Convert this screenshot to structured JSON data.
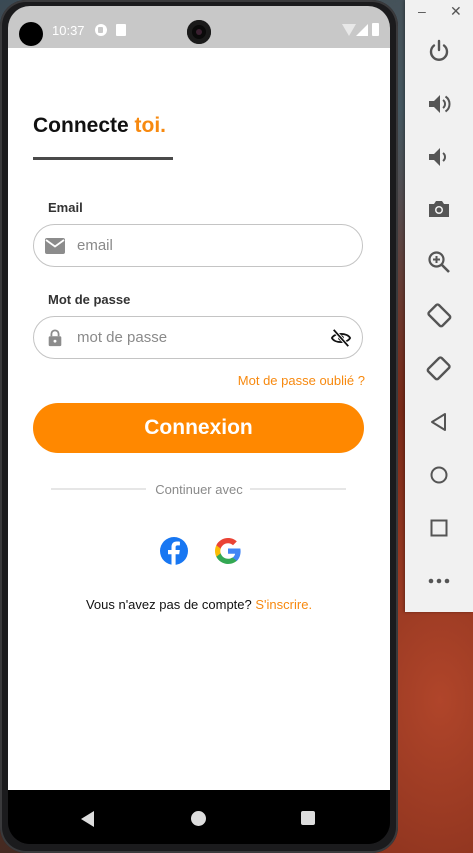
{
  "status_bar": {
    "time": "10:37"
  },
  "login": {
    "title_prefix": "Connecte",
    "title_accent": "toi.",
    "email_label": "Email",
    "email_placeholder": "email",
    "email_value": "",
    "password_label": "Mot de passe",
    "password_placeholder": "mot de passe",
    "password_value": "",
    "forgot_link": "Mot de passe oublié ?",
    "login_button": "Connexion",
    "divider_text": "Continuer avec",
    "signup_text": "Vous n'avez pas de compte?",
    "signup_link": "S'inscrire."
  },
  "emulator_panel": {
    "minimize": "–",
    "close": "✕",
    "buttons": [
      "power",
      "volume-up",
      "volume-down",
      "camera",
      "zoom",
      "rotate-left",
      "rotate-right",
      "back",
      "home",
      "overview",
      "more"
    ]
  },
  "colors": {
    "accent": "#ff8800",
    "accent_text": "#f7890f",
    "facebook": "#1877f2"
  }
}
